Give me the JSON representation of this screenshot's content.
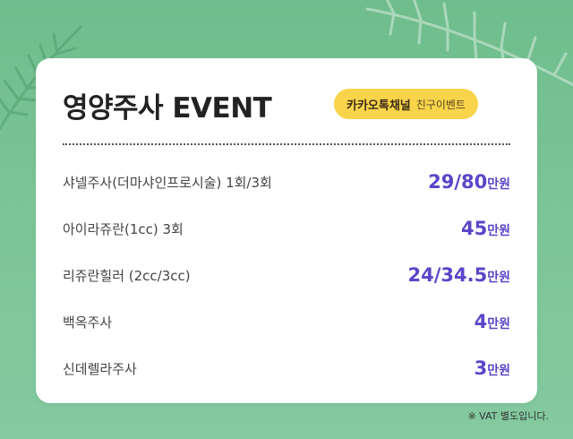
{
  "title": "영양주사 EVENT",
  "badge": {
    "primary": "카카오톡채널",
    "secondary": "친구이벤트"
  },
  "items": [
    {
      "name": "샤넬주사(더마샤인프로시술) 1회/3회",
      "price": "29/80",
      "unit": "만원"
    },
    {
      "name": "아이라쥬란(1cc) 3회",
      "price": "45",
      "unit": "만원"
    },
    {
      "name": "리쥬란힐러 (2cc/3cc)",
      "price": "24/34.5",
      "unit": "만원"
    },
    {
      "name": "백옥주사",
      "price": "4",
      "unit": "만원"
    },
    {
      "name": "신데렐라주사",
      "price": "3",
      "unit": "만원"
    }
  ],
  "note": "※ VAT 별도입니다.",
  "colors": {
    "background": "#7cc497",
    "badge": "#f8d44a",
    "price": "#5b45c8"
  }
}
